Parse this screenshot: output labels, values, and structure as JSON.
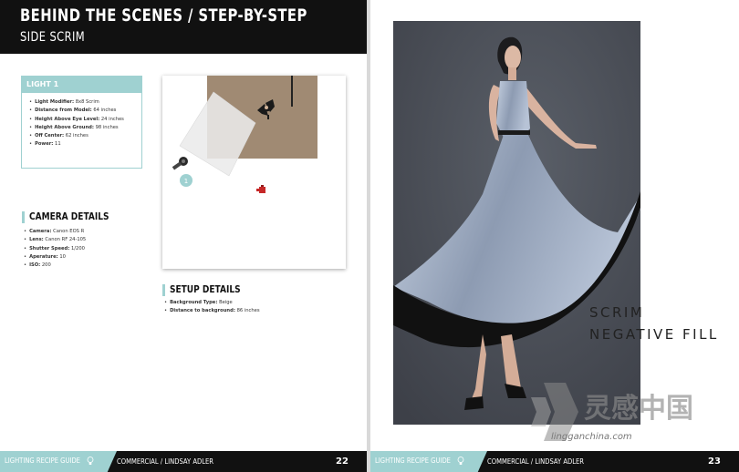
{
  "left_page": {
    "title": "BEHIND THE SCENES / STEP-BY-STEP",
    "subtitle": "SIDE SCRIM",
    "light": {
      "heading": "LIGHT 1",
      "specs": [
        {
          "label": "Light Modifier:",
          "value": "8x8 Scrim"
        },
        {
          "label": "Distance from Model:",
          "value": "64 inches"
        },
        {
          "label": "Height Above Eye Level:",
          "value": "24 inches"
        },
        {
          "label": "Height Above Ground:",
          "value": "98 inches"
        },
        {
          "label": "Off Center:",
          "value": "62 inches"
        },
        {
          "label": "Power:",
          "value": "11"
        }
      ]
    },
    "camera": {
      "heading": "CAMERA DETAILS",
      "specs": [
        {
          "label": "Camera:",
          "value": "Canon EOS R"
        },
        {
          "label": "Lens:",
          "value": "Canon RF 24-105"
        },
        {
          "label": "Shutter Speed:",
          "value": "1/200"
        },
        {
          "label": "Aperature:",
          "value": "10"
        },
        {
          "label": "ISO:",
          "value": "200"
        }
      ]
    },
    "setup": {
      "heading": "SETUP DETAILS",
      "specs": [
        {
          "label": "Background Type:",
          "value": "Beige"
        },
        {
          "label": "Distance to background:",
          "value": "86 inches"
        }
      ]
    },
    "diagram": {
      "light_marker": "1"
    },
    "footer": {
      "guide": "LIGHTING RECIPE GUIDE",
      "credit": "COMMERCIAL / LINDSAY ADLER",
      "page": "22"
    }
  },
  "right_page": {
    "overlay_line1": "SCRIM",
    "overlay_line2": "NEGATIVE FILL",
    "footer": {
      "guide": "LIGHTING RECIPE GUIDE",
      "credit": "COMMERCIAL / LINDSAY ADLER",
      "page": "23"
    }
  },
  "watermark": {
    "text": "灵感中国",
    "site": "lingganchina.com"
  },
  "colors": {
    "accent": "#9fd1d1",
    "dark": "#111111",
    "backdrop": "#4a4e56",
    "background_paper": "#a08a73",
    "dress": "#9aa8bd"
  }
}
